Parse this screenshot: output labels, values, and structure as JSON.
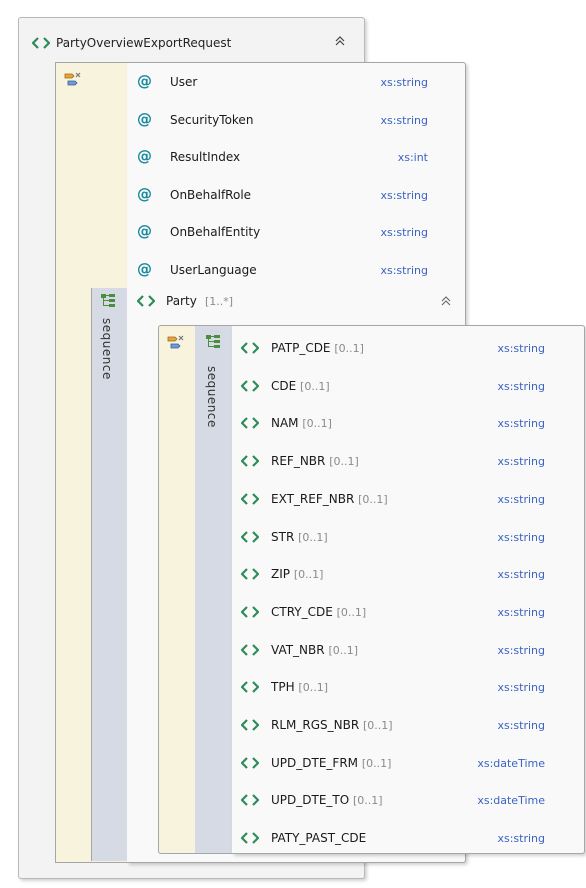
{
  "root": {
    "name": "PartyOverviewExportRequest",
    "collapse_glyph": "≈"
  },
  "attributes": [
    {
      "name": "User",
      "type": "xs:string"
    },
    {
      "name": "SecurityToken",
      "type": "xs:string"
    },
    {
      "name": "ResultIndex",
      "type": "xs:int"
    },
    {
      "name": "OnBehalfRole",
      "type": "xs:string"
    },
    {
      "name": "OnBehalfEntity",
      "type": "xs:string"
    },
    {
      "name": "UserLanguage",
      "type": "xs:string"
    }
  ],
  "outer_sequence": {
    "label": "sequence"
  },
  "party": {
    "name": "Party",
    "cardinality": "[1..*]",
    "collapse_glyph": "≈"
  },
  "inner_sequence": {
    "label": "sequence"
  },
  "elements": [
    {
      "name": "PATP_CDE",
      "cardinality": "[0..1]",
      "type": "xs:string"
    },
    {
      "name": "CDE",
      "cardinality": "[0..1]",
      "type": "xs:string"
    },
    {
      "name": "NAM",
      "cardinality": "[0..1]",
      "type": "xs:string"
    },
    {
      "name": "REF_NBR",
      "cardinality": "[0..1]",
      "type": "xs:string"
    },
    {
      "name": "EXT_REF_NBR",
      "cardinality": "[0..1]",
      "type": "xs:string"
    },
    {
      "name": "STR",
      "cardinality": "[0..1]",
      "type": "xs:string"
    },
    {
      "name": "ZIP",
      "cardinality": "[0..1]",
      "type": "xs:string"
    },
    {
      "name": "CTRY_CDE",
      "cardinality": "[0..1]",
      "type": "xs:string"
    },
    {
      "name": "VAT_NBR",
      "cardinality": "[0..1]",
      "type": "xs:string"
    },
    {
      "name": "TPH",
      "cardinality": "[0..1]",
      "type": "xs:string"
    },
    {
      "name": "RLM_RGS_NBR",
      "cardinality": "[0..1]",
      "type": "xs:string"
    },
    {
      "name": "UPD_DTE_FRM",
      "cardinality": "[0..1]",
      "type": "xs:dateTime"
    },
    {
      "name": "UPD_DTE_TO",
      "cardinality": "[0..1]",
      "type": "xs:dateTime"
    },
    {
      "name": "PATY_PAST_CDE",
      "cardinality": "",
      "type": "xs:string"
    }
  ],
  "icons": {
    "element": "element-icon",
    "attribute": "attribute-icon",
    "complex-type": "complex-type-icon",
    "sequence": "sequence-icon",
    "collapse": "collapse-icon"
  },
  "colors": {
    "element_icon": "#2e8b57",
    "attribute_icon": "#178a9c",
    "type_text": "#3b63c4",
    "complex_bg": "#f7f3dc",
    "sequence_bg": "#d5dae5"
  }
}
